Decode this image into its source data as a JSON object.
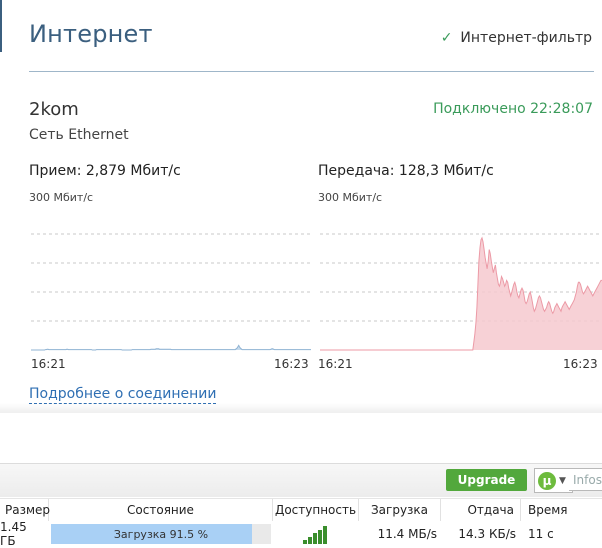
{
  "router": {
    "title": "Интернет",
    "filter_label": "Интернет-фильтр",
    "connection": {
      "name": "2kom",
      "type": "Сеть Ethernet",
      "status": "Подключено 22:28:07"
    },
    "receive": {
      "label": "Прием: 2,879 Мбит/с",
      "scale": "300 Мбит/с",
      "time_start": "16:21",
      "time_end": "16:23"
    },
    "transmit": {
      "label": "Передача: 128,3 Мбит/с",
      "scale": "300 Мбит/с",
      "time_start": "16:21",
      "time_end": "16:23"
    },
    "details_link": "Подробнее о соединении"
  },
  "chart_data": [
    {
      "type": "area",
      "ylim": [
        0,
        300
      ],
      "color": "#bcd5ea",
      "values": [
        0,
        0,
        0,
        0,
        0,
        0,
        0,
        0,
        0,
        0,
        0,
        0,
        0,
        0,
        0,
        0,
        0,
        1,
        1,
        2,
        2,
        1,
        1,
        1,
        1,
        1,
        1,
        1,
        1,
        1,
        1,
        1,
        1,
        1,
        1,
        1,
        1,
        1,
        1,
        1,
        1,
        1,
        2,
        2,
        1,
        1,
        1,
        1,
        1,
        1,
        1,
        1,
        1,
        1,
        1,
        1,
        1,
        1,
        1,
        1,
        1,
        1,
        1,
        1,
        1,
        1,
        1,
        1,
        1,
        1,
        1,
        1,
        0,
        0,
        0,
        0,
        0,
        1,
        1,
        1,
        1,
        1,
        1,
        1,
        1,
        1,
        1,
        1,
        1,
        1,
        1,
        1,
        1,
        1,
        1,
        1,
        1,
        1,
        1,
        1,
        1,
        1,
        1,
        1,
        1,
        1,
        1,
        0,
        0,
        0,
        0,
        0,
        0,
        0,
        0,
        0,
        0,
        0,
        0,
        1,
        1,
        1,
        1,
        1,
        1,
        1,
        1,
        1,
        1,
        1,
        1,
        1,
        1,
        1,
        1,
        1,
        1,
        1,
        1,
        1,
        1,
        2,
        2,
        2,
        2,
        2,
        2,
        3,
        3,
        3,
        3,
        2,
        2,
        2,
        2,
        2,
        2,
        2,
        2,
        2,
        2,
        2,
        2,
        2,
        2,
        1,
        1,
        1,
        1,
        1,
        1,
        1,
        1,
        1,
        1,
        1,
        1,
        1,
        1,
        1,
        1,
        1,
        1,
        1,
        1,
        1,
        1,
        1,
        1,
        1,
        1,
        1,
        1,
        1,
        1,
        1,
        1,
        1,
        1,
        1,
        1,
        1,
        1,
        1,
        1,
        1,
        1,
        1,
        1,
        1,
        1,
        1,
        1,
        1,
        1,
        1,
        1,
        1,
        1,
        1,
        1,
        1,
        1,
        1,
        1,
        1,
        1,
        1,
        1,
        1,
        1,
        1,
        1,
        1,
        1,
        1,
        1,
        1,
        1,
        1,
        1,
        3,
        5,
        8,
        12,
        8,
        5,
        3,
        1,
        1,
        1,
        1,
        1,
        1,
        1,
        1,
        1,
        1,
        1,
        1,
        1,
        1,
        1,
        1,
        1,
        1,
        1,
        1,
        1,
        1,
        1,
        1,
        1,
        1,
        1,
        1,
        1,
        1,
        1,
        1,
        1,
        1,
        2,
        3,
        3,
        2,
        1,
        1,
        1,
        1,
        1,
        1,
        1,
        1,
        1,
        1,
        1,
        1,
        1,
        1,
        1,
        1,
        1,
        1,
        1,
        1,
        1,
        1,
        1,
        1,
        1,
        1,
        1,
        1,
        1,
        1,
        1,
        1,
        1,
        1,
        1,
        1,
        1,
        1,
        1,
        1,
        1,
        1,
        1,
        1
      ]
    },
    {
      "type": "area",
      "ylim": [
        0,
        300
      ],
      "color": "#f6c9cf",
      "values": [
        0,
        0,
        0,
        0,
        0,
        0,
        0,
        0,
        0,
        0,
        0,
        0,
        0,
        0,
        0,
        0,
        0,
        0,
        0,
        0,
        0,
        0,
        0,
        0,
        0,
        0,
        0,
        0,
        0,
        0,
        0,
        0,
        0,
        0,
        0,
        0,
        0,
        0,
        0,
        0,
        0,
        0,
        0,
        0,
        0,
        0,
        0,
        0,
        0,
        0,
        0,
        0,
        0,
        0,
        0,
        0,
        0,
        0,
        0,
        0,
        0,
        0,
        0,
        0,
        0,
        0,
        0,
        0,
        0,
        0,
        0,
        0,
        0,
        0,
        0,
        0,
        0,
        0,
        0,
        0,
        0,
        0,
        0,
        0,
        0,
        0,
        0,
        0,
        0,
        0,
        0,
        0,
        0,
        0,
        0,
        0,
        0,
        0,
        0,
        0,
        0,
        0,
        0,
        0,
        0,
        0,
        0,
        0,
        0,
        0,
        0,
        0,
        0,
        0,
        0,
        0,
        0,
        0,
        0,
        0,
        0,
        0,
        0,
        0,
        0,
        0,
        0,
        0,
        0,
        0,
        0,
        0,
        0,
        0,
        0,
        0,
        0,
        0,
        0,
        0,
        0,
        0,
        0,
        0,
        0,
        0,
        0,
        0,
        0,
        0,
        20,
        40,
        70,
        110,
        170,
        230,
        265,
        285,
        290,
        280,
        260,
        240,
        225,
        210,
        230,
        260,
        250,
        230,
        215,
        200,
        210,
        220,
        200,
        185,
        170,
        165,
        175,
        190,
        185,
        175,
        165,
        170,
        180,
        175,
        160,
        150,
        140,
        150,
        160,
        170,
        175,
        165,
        150,
        140,
        135,
        145,
        155,
        160,
        155,
        140,
        125,
        120,
        125,
        135,
        145,
        150,
        140,
        125,
        110,
        100,
        105,
        115,
        125,
        135,
        140,
        135,
        125,
        115,
        105,
        100,
        105,
        110,
        120,
        125,
        120,
        110,
        100,
        95,
        100,
        110,
        115,
        120,
        115,
        110,
        105,
        100,
        110,
        115,
        120,
        125,
        120,
        115,
        110,
        105,
        110,
        115,
        120,
        125,
        130,
        140,
        150,
        165,
        175,
        175,
        170,
        160,
        150,
        145,
        150,
        155,
        160,
        165,
        160,
        155,
        150,
        145,
        140,
        145,
        150,
        155,
        160,
        165,
        170,
        175,
        180,
        180
      ]
    }
  ],
  "utorrent": {
    "upgrade_label": "Upgrade",
    "logo_letter": "µ",
    "search_placeholder": "Infosp",
    "columns": {
      "size": "Размер",
      "status": "Состояние",
      "availability": "Доступность",
      "download": "Загрузка",
      "upload": "Отдача",
      "time": "Время"
    },
    "row": {
      "size": "1.45 ГБ",
      "status": "Загрузка 91.5 %",
      "progress": 0.915,
      "availability_bars": 5,
      "download": "11.4 МБ/s",
      "upload": "14.3 КБ/s",
      "time": "11 с"
    }
  },
  "colors": {
    "accent": "#3b5f7f",
    "connected_green": "#3a9b5a",
    "link_blue": "#2f6fb3",
    "upgrade_green": "#52a83c",
    "progress_blue": "#a9d0f5"
  }
}
